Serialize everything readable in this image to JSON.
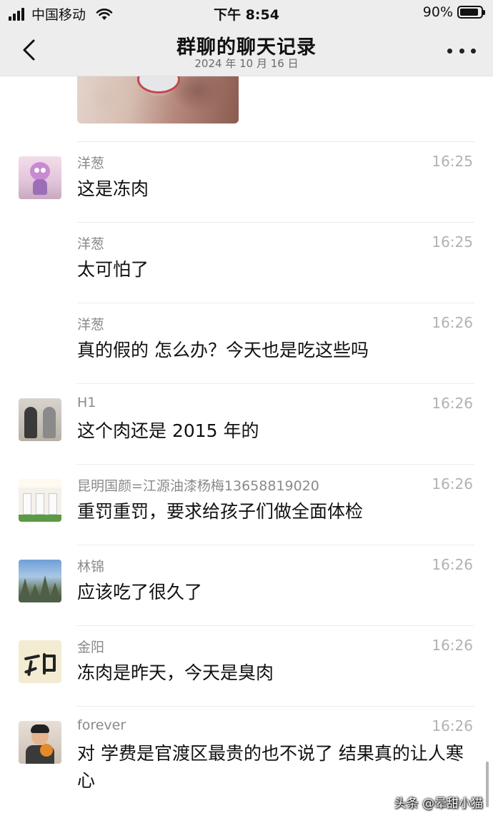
{
  "status_bar": {
    "carrier": "中国移动",
    "time": "下午 8:54",
    "battery_text": "90%",
    "battery_level": 0.9,
    "icons": [
      "signal-icon",
      "wifi-icon",
      "battery-icon"
    ]
  },
  "nav": {
    "title": "群聊的聊天记录",
    "subtitle": "2024 年 10 月 16 日",
    "back_icon": "chevron-left-icon",
    "more_icon": "more-dots-icon"
  },
  "messages": [
    {
      "sender": "洋葱",
      "time": "16:25",
      "text": "这是冻肉",
      "avatar": "avatar-onion"
    },
    {
      "sender": "洋葱",
      "time": "16:25",
      "text": "太可怕了",
      "avatar": ""
    },
    {
      "sender": "洋葱",
      "time": "16:26",
      "text": "真的假的  怎么办？今天也是吃这些吗",
      "avatar": ""
    },
    {
      "sender": "H1",
      "time": "16:26",
      "text": "这个肉还是 2015 年的",
      "avatar": "avatar-h1"
    },
    {
      "sender": "昆明国颜=江源油漆杨梅13658819020",
      "time": "16:26",
      "text": "重罚重罚，要求给孩子们做全面体检",
      "avatar": "avatar-kunming"
    },
    {
      "sender": "林锦",
      "time": "16:26",
      "text": "应该吃了很久了",
      "avatar": "avatar-linjin"
    },
    {
      "sender": "金阳",
      "time": "16:26",
      "text": "冻肉是昨天，今天是臭肉",
      "avatar": "avatar-jinyang"
    },
    {
      "sender": "forever",
      "time": "16:26",
      "text": "对  学费是官渡区最贵的也不说了  结果真的让人寒心",
      "avatar": "avatar-forever"
    }
  ],
  "watermark": "头条 @晕甜小猫"
}
